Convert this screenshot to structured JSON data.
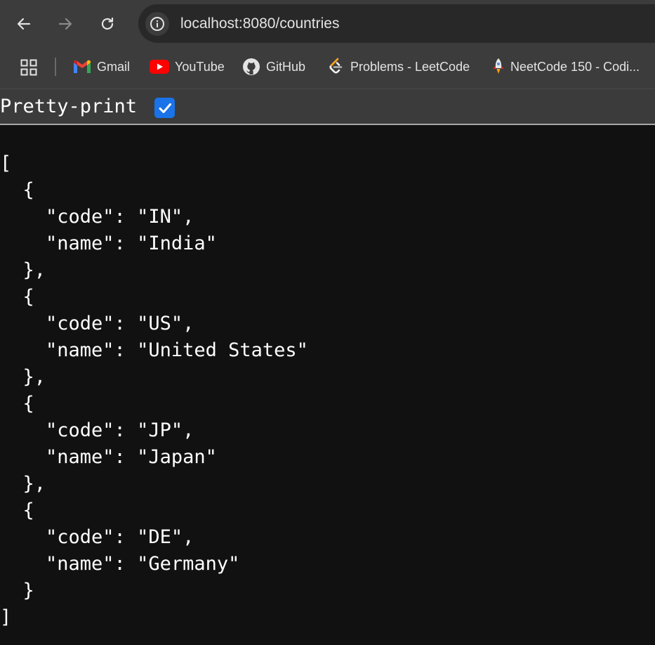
{
  "browser": {
    "url": "localhost:8080/countries",
    "bookmarks": [
      {
        "label": "Gmail",
        "icon": "gmail-icon"
      },
      {
        "label": "YouTube",
        "icon": "youtube-icon"
      },
      {
        "label": "GitHub",
        "icon": "github-icon"
      },
      {
        "label": "Problems - LeetCode",
        "icon": "leetcode-icon"
      },
      {
        "label": "NeetCode 150 - Codi...",
        "icon": "rocket-icon"
      }
    ]
  },
  "viewer": {
    "pretty_print_label": "Pretty-print",
    "pretty_print_checked": true
  },
  "json_text": "[\n  {\n    \"code\": \"IN\",\n    \"name\": \"India\"\n  },\n  {\n    \"code\": \"US\",\n    \"name\": \"United States\"\n  },\n  {\n    \"code\": \"JP\",\n    \"name\": \"Japan\"\n  },\n  {\n    \"code\": \"DE\",\n    \"name\": \"Germany\"\n  }\n]",
  "colors": {
    "toolbar": "#3c3c3c",
    "omnibox": "#282828",
    "page_background": "#111111",
    "checkbox": "#1a73e8"
  }
}
